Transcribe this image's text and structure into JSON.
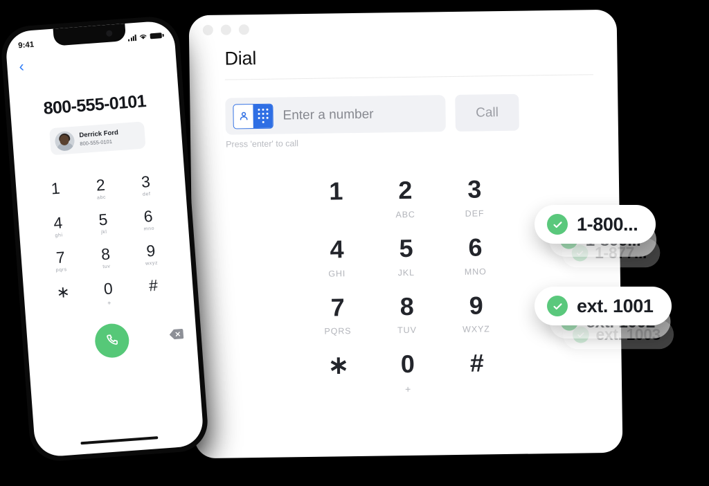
{
  "desktop": {
    "window_controls": [
      "close",
      "minimize",
      "maximize"
    ],
    "page_title": "Dial",
    "input": {
      "placeholder": "Enter a number",
      "value": "",
      "hint": "Press 'enter' to call",
      "toggle_left_icon": "contact-person-icon",
      "toggle_right_icon": "keypad-dots-icon"
    },
    "call_button": "Call",
    "keypad": [
      {
        "num": "1",
        "sub": ""
      },
      {
        "num": "2",
        "sub": "ABC"
      },
      {
        "num": "3",
        "sub": "DEF"
      },
      {
        "num": "4",
        "sub": "GHI"
      },
      {
        "num": "5",
        "sub": "JKL"
      },
      {
        "num": "6",
        "sub": "MNO"
      },
      {
        "num": "7",
        "sub": "PQRS"
      },
      {
        "num": "8",
        "sub": "TUV"
      },
      {
        "num": "9",
        "sub": "WXYZ"
      },
      {
        "num": "∗",
        "sub": ""
      },
      {
        "num": "0",
        "sub": "+"
      },
      {
        "num": "#",
        "sub": ""
      }
    ]
  },
  "phone": {
    "status": {
      "time": "9:41",
      "signal_icon": "signal-bars-icon",
      "wifi_icon": "wifi-icon",
      "battery_icon": "battery-icon"
    },
    "back_icon": "chevron-left-icon",
    "dialed_number": "800-555-0101",
    "contact": {
      "name": "Derrick Ford",
      "number": "800-555-0101",
      "avatar": "contact-photo"
    },
    "keypad": [
      {
        "num": "1",
        "sub": ""
      },
      {
        "num": "2",
        "sub": "abc"
      },
      {
        "num": "3",
        "sub": "def"
      },
      {
        "num": "4",
        "sub": "ghi"
      },
      {
        "num": "5",
        "sub": "jkl"
      },
      {
        "num": "6",
        "sub": "mno"
      },
      {
        "num": "7",
        "sub": "pqrs"
      },
      {
        "num": "8",
        "sub": "tuv"
      },
      {
        "num": "9",
        "sub": "wxyz"
      },
      {
        "num": "∗",
        "sub": ""
      },
      {
        "num": "0",
        "sub": "+"
      },
      {
        "num": "#",
        "sub": ""
      }
    ],
    "call_icon": "phone-handset-icon",
    "backspace_icon": "backspace-delete-icon"
  },
  "pills": {
    "group_one": [
      {
        "label": "1-800...",
        "status_icon": "check-circle-icon"
      },
      {
        "label": "1-800...",
        "status_icon": "check-circle-icon"
      },
      {
        "label": "1-877...",
        "status_icon": "check-circle-icon"
      }
    ],
    "group_two": [
      {
        "label": "ext. 1001",
        "status_icon": "check-circle-icon"
      },
      {
        "label": "ext. 1002",
        "status_icon": "check-circle-icon"
      },
      {
        "label": "ext. 1003",
        "status_icon": "check-circle-icon"
      }
    ]
  },
  "colors": {
    "accent_blue": "#2f6fe4",
    "success_green": "#5ac87c",
    "call_green": "#56c878",
    "field_gray": "#f1f2f5",
    "text_dark": "#1b1e24",
    "text_muted": "#9b9da4"
  }
}
